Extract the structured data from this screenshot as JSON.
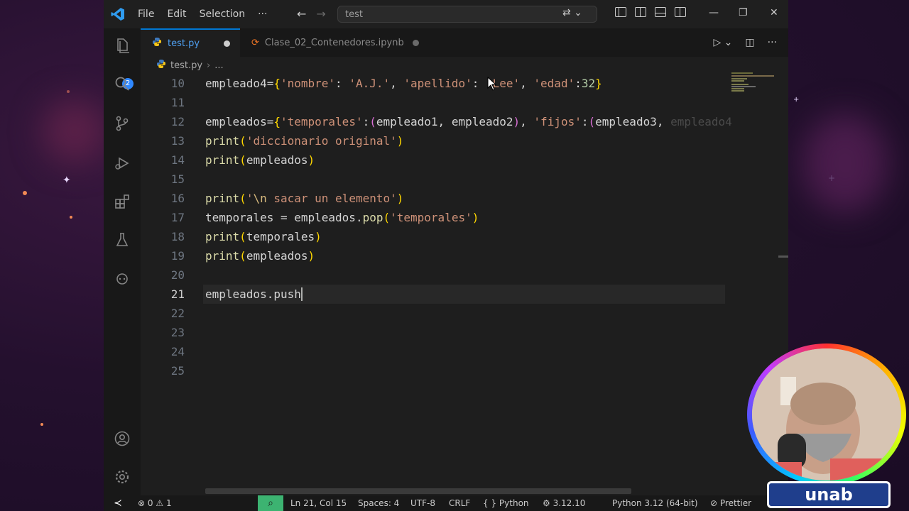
{
  "titlebar": {
    "menu": [
      "File",
      "Edit",
      "Selection",
      "···"
    ],
    "search_text": "test",
    "minimize": "—",
    "maximize": "❐",
    "close": "✕"
  },
  "activity_bar": {
    "explorer_badge": "2",
    "icons": [
      "files-icon",
      "search-icon",
      "source-control-icon",
      "run-debug-icon",
      "extensions-icon",
      "testing-icon",
      "copilot-icon",
      "account-icon",
      "settings-gear-icon"
    ]
  },
  "tabs": [
    {
      "label": "test.py",
      "active": true,
      "modified": true
    },
    {
      "label": "Clase_02_Contenedores.ipynb",
      "active": false,
      "modified": true
    }
  ],
  "breadcrumb": {
    "file": "test.py",
    "more": "..."
  },
  "editor": {
    "line_numbers": [
      "10",
      "11",
      "12",
      "13",
      "14",
      "15",
      "16",
      "17",
      "18",
      "19",
      "20",
      "21",
      "22",
      "23",
      "24",
      "25"
    ],
    "current_line": "21",
    "code": {
      "l10": {
        "a": "empleado4",
        "b": "=",
        "c": "{",
        "d": "'nombre'",
        "e": ": ",
        "f": "'A.J.'",
        "g": ", ",
        "h": "'apellido'",
        "i": ": ",
        "j": "'Lee'",
        "k": ", ",
        "l": "'edad'",
        "m": ":",
        "n": "32",
        "o": "}"
      },
      "l12": {
        "a": "empleados",
        "b": "=",
        "c": "{",
        "d": "'temporales'",
        "e": ":",
        "f": "(",
        "g": "empleado1, empleado2",
        "h": ")",
        "i": ", ",
        "j": "'fijos'",
        "k": ":",
        "l": "(",
        "m": "empleado3, ",
        "n": "empleado4"
      },
      "l13": {
        "a": "print",
        "b": "(",
        "c": "'diccionario original'",
        "d": ")"
      },
      "l14": {
        "a": "print",
        "b": "(",
        "c": "empleados",
        "d": ")"
      },
      "l16": {
        "a": "print",
        "b": "(",
        "c": "'",
        "d": "\\n",
        "e": " sacar un elemento'",
        "f": ")"
      },
      "l17": {
        "a": "temporales",
        "b": " = ",
        "c": "empleados",
        "d": ".",
        "e": "pop",
        "f": "(",
        "g": "'temporales'",
        "h": ")"
      },
      "l18": {
        "a": "print",
        "b": "(",
        "c": "temporales",
        "d": ")"
      },
      "l19": {
        "a": "print",
        "b": "(",
        "c": "empleados",
        "d": ")"
      },
      "l21": {
        "a": "empleados.push"
      }
    }
  },
  "statusbar": {
    "errors": "0",
    "warnings": "1",
    "position": "Ln 21, Col 15",
    "spaces": "Spaces: 4",
    "encoding": "UTF-8",
    "eol": "CRLF",
    "language": "Python",
    "py_version": "3.12.10",
    "interpreter": "Python 3.12 (64-bit)",
    "formatter": "Prettier",
    "braces": "{ }"
  },
  "overlay": {
    "logo": "unab"
  },
  "colors": {
    "accent": "#0078d4",
    "editor_bg": "#1e1e1e",
    "string": "#ce9178",
    "function": "#dcdcaa",
    "number": "#b5cea8",
    "bracket_gold": "#ffd700",
    "bracket_purple": "#da70d6",
    "bracket_blue": "#179fff"
  }
}
